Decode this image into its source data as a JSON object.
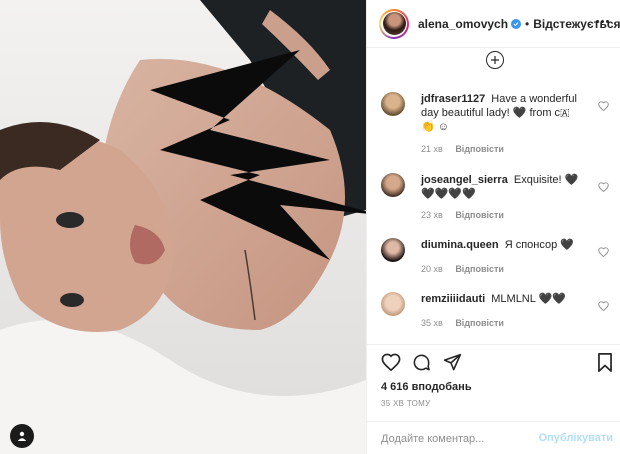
{
  "post": {
    "username": "alena_omovych",
    "separator": "•",
    "follow_label": "Відстежується",
    "photo": {
      "description_icon": "photo-post",
      "corner_icon": "tag-icon"
    }
  },
  "comments": [
    {
      "username": "jdfraser1127",
      "text": "Have a wonderful day beautiful lady! 🖤 from c🇦 👏 ☺",
      "age": "21 хв",
      "reply": "Відповісти"
    },
    {
      "username": "joseangel_sierra",
      "text": "Exquisite! 🖤🖤🖤🖤🖤",
      "age": "23 хв",
      "reply": "Відповісти"
    },
    {
      "username": "diumina.queen",
      "text": "Я спонсор 🖤",
      "age": "20 хв",
      "reply": "Відповісти"
    },
    {
      "username": "remziiiidauti",
      "text": "MLMLNL 🖤🖤",
      "age": "35 хв",
      "reply": "Відповісти"
    }
  ],
  "stats": {
    "likes": "4 616 вподобань",
    "time": "35 ХВ ТОМУ"
  },
  "composer": {
    "placeholder": "Додайте коментар...",
    "post_label": "Опублікувати"
  },
  "colors": {
    "accent": "#3897f0",
    "post_disabled": "#b2dffc",
    "meta": "#8e8e8e"
  }
}
